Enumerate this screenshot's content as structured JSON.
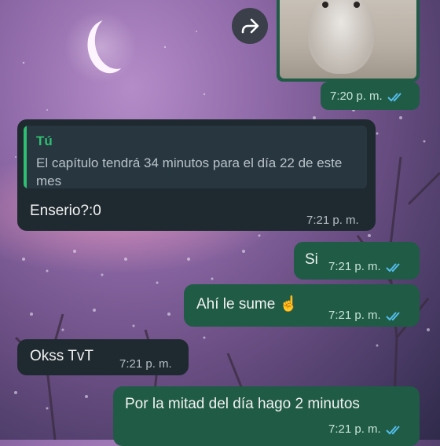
{
  "colors": {
    "incoming_bubble": "#1f2a30",
    "outgoing_bubble": "#1f5b45",
    "quote_author": "#2fbf71",
    "read_ticks": "#53bdeb"
  },
  "forward_icon": "forward-icon",
  "messages": [
    {
      "direction": "out",
      "type": "image",
      "time": "7:20 p. m.",
      "status": "read"
    },
    {
      "direction": "in",
      "reply_to": {
        "author": "Tú",
        "text": "El capítulo tendrá 34 minutos para el día 22 de este mes"
      },
      "text": "Enserio?:0",
      "time": "7:21 p. m."
    },
    {
      "direction": "out",
      "text": "Si",
      "time": "7:21 p. m.",
      "status": "read"
    },
    {
      "direction": "out",
      "text": "Ahí le sume ☝️",
      "time": "7:21 p. m.",
      "status": "read"
    },
    {
      "direction": "in",
      "text": "Okss TvT",
      "time": "7:21 p. m."
    },
    {
      "direction": "out",
      "text": "Por la mitad del día hago 2 minutos",
      "time": "7:21 p. m.",
      "status": "read"
    }
  ]
}
